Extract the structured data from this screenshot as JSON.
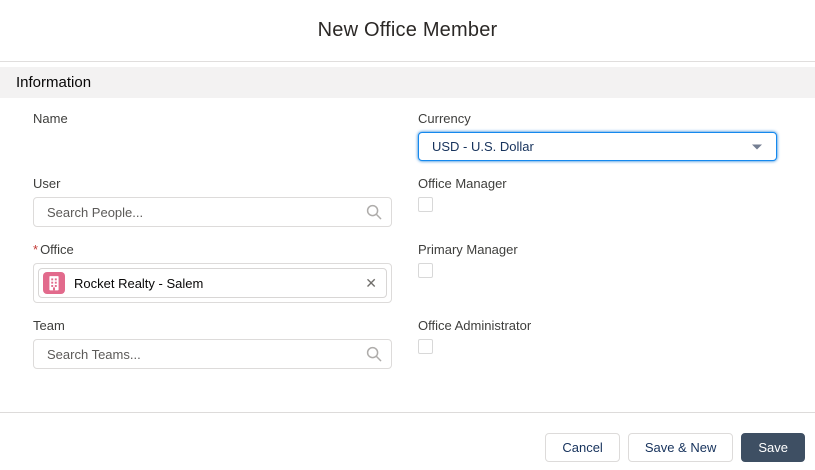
{
  "modal": {
    "title": "New Office Member",
    "section_title": "Information",
    "fields": {
      "name": {
        "label": "Name"
      },
      "currency": {
        "label": "Currency",
        "value": "USD - U.S. Dollar"
      },
      "user": {
        "label": "User",
        "placeholder": "Search People..."
      },
      "office_manager": {
        "label": "Office Manager",
        "checked": false
      },
      "office": {
        "label": "Office",
        "required_marker": "*",
        "selected_value": "Rocket Realty - Salem",
        "remove_glyph": "✕"
      },
      "primary_manager": {
        "label": "Primary Manager",
        "checked": false
      },
      "team": {
        "label": "Team",
        "placeholder": "Search Teams..."
      },
      "office_administrator": {
        "label": "Office Administrator",
        "checked": false
      }
    },
    "footer": {
      "cancel_label": "Cancel",
      "save_new_label": "Save & New",
      "save_label": "Save"
    },
    "icons": {
      "search": "search-icon",
      "office_record": "building-icon",
      "remove": "close-icon",
      "dropdown": "chevron-down-icon"
    },
    "colors": {
      "focus_border": "#1589EE",
      "focus_glow": "#0070D2",
      "save_button_bg": "#3E4F63",
      "neutral_button_text": "#16325C",
      "required_asterisk": "#C23934",
      "office_icon_bg": "#E26A8C",
      "section_bg": "#F3F2F2",
      "input_border": "#DDDBDA"
    }
  }
}
